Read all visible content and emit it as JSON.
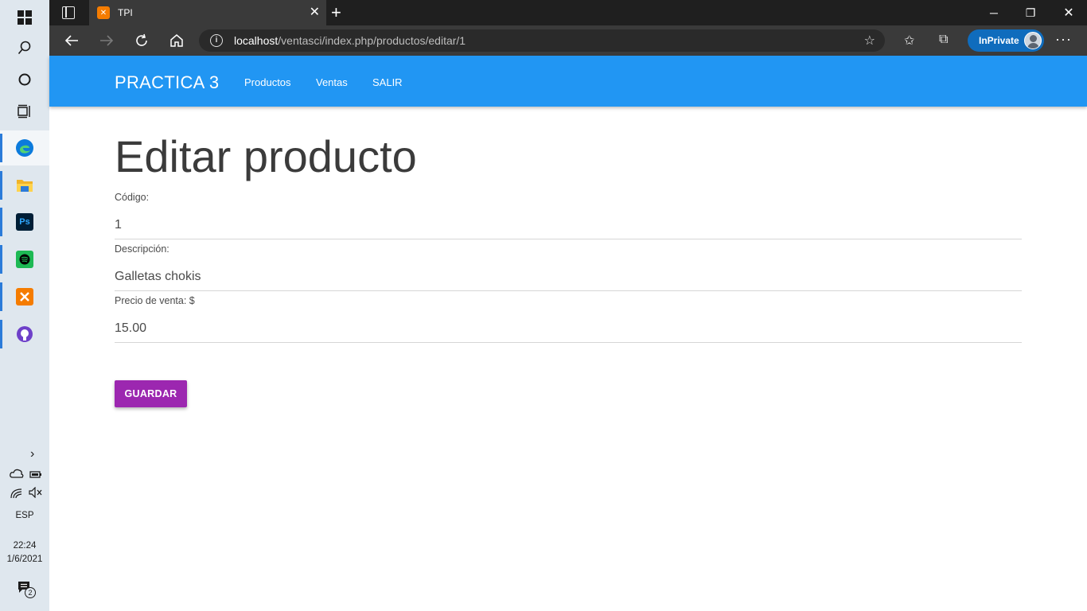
{
  "taskbar": {
    "apps": [
      {
        "name": "Edge",
        "color": "#0c7bdc"
      },
      {
        "name": "File Explorer",
        "color": "#f0b429"
      },
      {
        "name": "Photoshop",
        "label": "Ps",
        "color": "#001e36"
      },
      {
        "name": "Spotify",
        "color": "#1db954"
      },
      {
        "name": "XAMPP",
        "color": "#f57c00"
      },
      {
        "name": "GitHub Desktop",
        "color": "#6e40c9"
      }
    ],
    "language": "ESP",
    "time": "22:24",
    "date": "1/6/2021",
    "notifications_count": "2"
  },
  "browser": {
    "tab_title": "TPI",
    "url_host": "localhost",
    "url_path": "/ventasci/index.php/productos/editar/1",
    "inprivate_label": "InPrivate"
  },
  "appnav": {
    "brand": "PRACTICA 3",
    "links": [
      "Productos",
      "Ventas",
      "SALIR"
    ],
    "bg_color": "#2196f3"
  },
  "form": {
    "heading": "Editar producto",
    "fields": [
      {
        "label": "Código:",
        "value": "1"
      },
      {
        "label": "Descripción:",
        "value": "Galletas chokis"
      },
      {
        "label": "Precio de venta: $",
        "value": "15.00"
      }
    ],
    "save_label": "GUARDAR",
    "save_color": "#9c27b0"
  }
}
